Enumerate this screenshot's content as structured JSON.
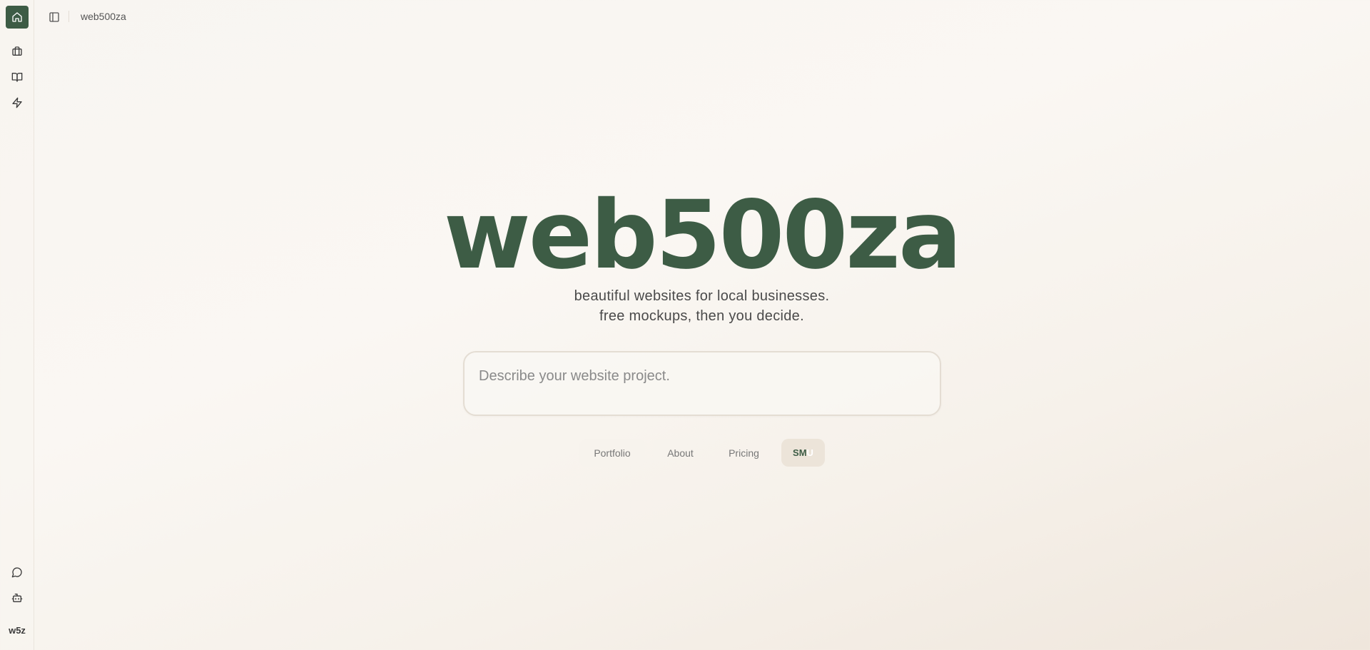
{
  "app": {
    "title": "web500za",
    "brand_short": "w5z"
  },
  "sidebar": {
    "items": [
      {
        "name": "home",
        "icon": "home-icon"
      },
      {
        "name": "portfolio",
        "icon": "briefcase-icon"
      },
      {
        "name": "about",
        "icon": "book-open-icon"
      },
      {
        "name": "pricing",
        "icon": "zap-icon"
      }
    ],
    "bottom_items": [
      {
        "name": "chat",
        "icon": "message-circle-icon"
      },
      {
        "name": "bot",
        "icon": "bot-icon"
      }
    ]
  },
  "hero": {
    "title": "web500za",
    "subtitle_line1": "beautiful websites for local businesses.",
    "subtitle_line2": "free mockups, then you decide."
  },
  "prompt": {
    "placeholder": "Describe your website project.",
    "value": ""
  },
  "nav_pills": {
    "portfolio": "Portfolio",
    "about": "About",
    "pricing": "Pricing",
    "smu_main": "SM",
    "smu_fade": "U"
  },
  "colors": {
    "accent": "#3d5c45",
    "background": "#f8f5f1",
    "text_muted": "#777777"
  }
}
